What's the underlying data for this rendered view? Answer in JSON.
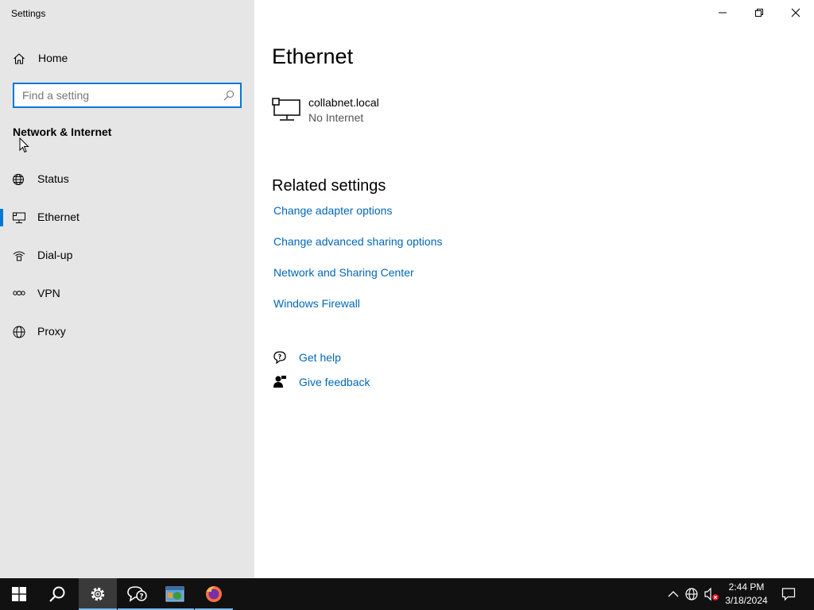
{
  "window": {
    "title": "Settings"
  },
  "sidebar": {
    "home_label": "Home",
    "search_placeholder": "Find a setting",
    "section_title": "Network & Internet",
    "items": [
      {
        "label": "Status",
        "icon": "globe-status-icon",
        "active": false
      },
      {
        "label": "Ethernet",
        "icon": "ethernet-icon",
        "active": true
      },
      {
        "label": "Dial-up",
        "icon": "dialup-icon",
        "active": false
      },
      {
        "label": "VPN",
        "icon": "vpn-icon",
        "active": false
      },
      {
        "label": "Proxy",
        "icon": "globe-icon",
        "active": false
      }
    ]
  },
  "main": {
    "title": "Ethernet",
    "network": {
      "name": "collabnet.local",
      "status": "No Internet"
    },
    "related_title": "Related settings",
    "related_links": [
      "Change adapter options",
      "Change advanced sharing options",
      "Network and Sharing Center",
      "Windows Firewall"
    ],
    "get_help": "Get help",
    "give_feedback": "Give feedback"
  },
  "taskbar": {
    "time": "2:44 PM",
    "date": "3/18/2024",
    "apps": [
      "start",
      "search",
      "settings",
      "feedback-hub",
      "windows-explorer",
      "firefox"
    ]
  },
  "colors": {
    "accent": "#0078d7",
    "link": "#0067b8",
    "sidebar_bg": "#e6e6e6",
    "taskbar_bg": "#111111"
  }
}
